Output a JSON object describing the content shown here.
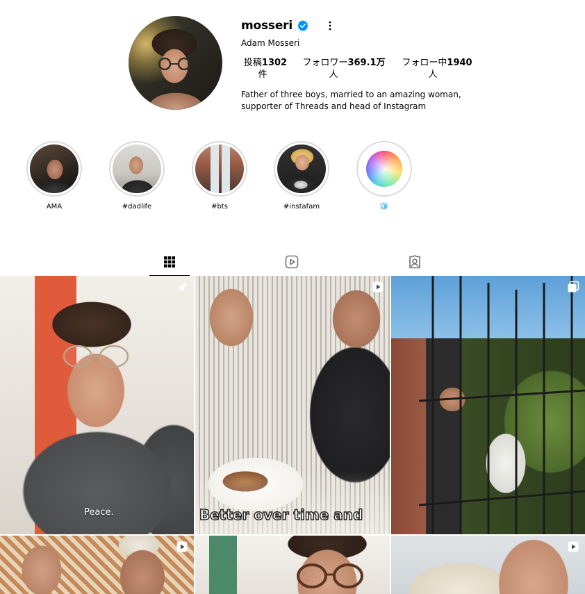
{
  "profile": {
    "username": "mosseri",
    "full_name": "Adam Mosseri",
    "verified": true,
    "stats": {
      "posts_label": "投稿",
      "posts_value": "1302",
      "posts_unit": "件",
      "followers_label": "フォロワー",
      "followers_value": "369.1万",
      "followers_unit": "人",
      "following_label": "フォロー中",
      "following_value": "1940",
      "following_unit": "人"
    },
    "bio_line1": "Father of three boys, married to an amazing woman,",
    "bio_line2": "supporter of Threads and head of Instagram"
  },
  "highlights": [
    {
      "label": "AMA"
    },
    {
      "label": "#dadlife"
    },
    {
      "label": "#bts"
    },
    {
      "label": "#instafam"
    },
    {
      "label": "🧊"
    }
  ],
  "tabs": [
    {
      "name": "posts",
      "icon": "grid-icon",
      "active": true
    },
    {
      "name": "reels",
      "icon": "reels-icon",
      "active": false
    },
    {
      "name": "tagged",
      "icon": "tagged-icon",
      "active": false
    }
  ],
  "posts": [
    {
      "badge": "pin-icon",
      "caption": "Peace."
    },
    {
      "badge": "reel-icon",
      "caption": "Better over time and"
    },
    {
      "badge": "carousel-icon",
      "caption": ""
    },
    {
      "badge": "reel-icon",
      "caption": ""
    },
    {
      "badge": "",
      "caption": ""
    },
    {
      "badge": "reel-icon",
      "caption": ""
    }
  ],
  "colors": {
    "verified": "#0095f6",
    "ring": "#dbdbdb",
    "text": "#000000"
  }
}
